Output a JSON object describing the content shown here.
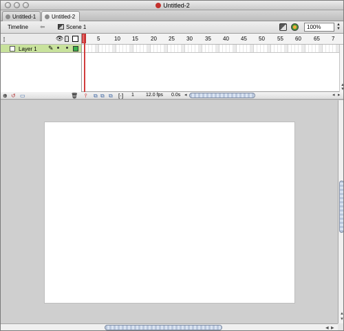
{
  "window": {
    "title": "Untitled-2"
  },
  "tabs": [
    {
      "label": "Untitled-1"
    },
    {
      "label": "Untitled-2"
    }
  ],
  "timeline_bar": {
    "timeline_label": "Timeline",
    "scene_label": "Scene 1",
    "zoom_value": "100%"
  },
  "layers": [
    {
      "name": "Layer 1"
    }
  ],
  "ruler": {
    "ticks": [
      "5",
      "10",
      "15",
      "20",
      "25",
      "30",
      "35",
      "40",
      "45",
      "50",
      "55",
      "60",
      "65",
      "7"
    ]
  },
  "status": {
    "current_frame": "1",
    "frame_rate": "12.0 fps",
    "elapsed_time": "0.0s"
  },
  "colors": {
    "layer_highlight": "#c8e29c",
    "playhead": "#d23b3b",
    "layer_outline": "#3ab14b",
    "stage": "#ffffff",
    "workspace": "#cfcfcf"
  }
}
